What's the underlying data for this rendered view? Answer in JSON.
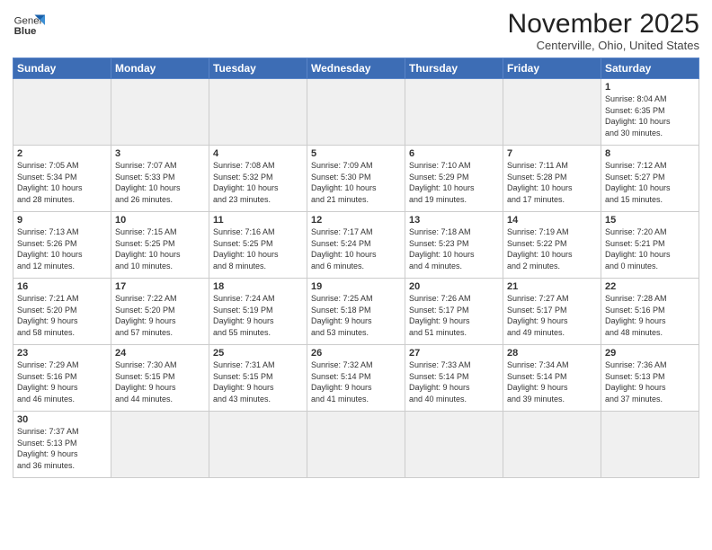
{
  "header": {
    "logo_text_regular": "General",
    "logo_text_bold": "Blue",
    "title": "November 2025",
    "subtitle": "Centerville, Ohio, United States"
  },
  "weekdays": [
    "Sunday",
    "Monday",
    "Tuesday",
    "Wednesday",
    "Thursday",
    "Friday",
    "Saturday"
  ],
  "weeks": [
    [
      {
        "day": "",
        "info": ""
      },
      {
        "day": "",
        "info": ""
      },
      {
        "day": "",
        "info": ""
      },
      {
        "day": "",
        "info": ""
      },
      {
        "day": "",
        "info": ""
      },
      {
        "day": "",
        "info": ""
      },
      {
        "day": "1",
        "info": "Sunrise: 8:04 AM\nSunset: 6:35 PM\nDaylight: 10 hours\nand 30 minutes."
      }
    ],
    [
      {
        "day": "2",
        "info": "Sunrise: 7:05 AM\nSunset: 5:34 PM\nDaylight: 10 hours\nand 28 minutes."
      },
      {
        "day": "3",
        "info": "Sunrise: 7:07 AM\nSunset: 5:33 PM\nDaylight: 10 hours\nand 26 minutes."
      },
      {
        "day": "4",
        "info": "Sunrise: 7:08 AM\nSunset: 5:32 PM\nDaylight: 10 hours\nand 23 minutes."
      },
      {
        "day": "5",
        "info": "Sunrise: 7:09 AM\nSunset: 5:30 PM\nDaylight: 10 hours\nand 21 minutes."
      },
      {
        "day": "6",
        "info": "Sunrise: 7:10 AM\nSunset: 5:29 PM\nDaylight: 10 hours\nand 19 minutes."
      },
      {
        "day": "7",
        "info": "Sunrise: 7:11 AM\nSunset: 5:28 PM\nDaylight: 10 hours\nand 17 minutes."
      },
      {
        "day": "8",
        "info": "Sunrise: 7:12 AM\nSunset: 5:27 PM\nDaylight: 10 hours\nand 15 minutes."
      }
    ],
    [
      {
        "day": "9",
        "info": "Sunrise: 7:13 AM\nSunset: 5:26 PM\nDaylight: 10 hours\nand 12 minutes."
      },
      {
        "day": "10",
        "info": "Sunrise: 7:15 AM\nSunset: 5:25 PM\nDaylight: 10 hours\nand 10 minutes."
      },
      {
        "day": "11",
        "info": "Sunrise: 7:16 AM\nSunset: 5:25 PM\nDaylight: 10 hours\nand 8 minutes."
      },
      {
        "day": "12",
        "info": "Sunrise: 7:17 AM\nSunset: 5:24 PM\nDaylight: 10 hours\nand 6 minutes."
      },
      {
        "day": "13",
        "info": "Sunrise: 7:18 AM\nSunset: 5:23 PM\nDaylight: 10 hours\nand 4 minutes."
      },
      {
        "day": "14",
        "info": "Sunrise: 7:19 AM\nSunset: 5:22 PM\nDaylight: 10 hours\nand 2 minutes."
      },
      {
        "day": "15",
        "info": "Sunrise: 7:20 AM\nSunset: 5:21 PM\nDaylight: 10 hours\nand 0 minutes."
      }
    ],
    [
      {
        "day": "16",
        "info": "Sunrise: 7:21 AM\nSunset: 5:20 PM\nDaylight: 9 hours\nand 58 minutes."
      },
      {
        "day": "17",
        "info": "Sunrise: 7:22 AM\nSunset: 5:20 PM\nDaylight: 9 hours\nand 57 minutes."
      },
      {
        "day": "18",
        "info": "Sunrise: 7:24 AM\nSunset: 5:19 PM\nDaylight: 9 hours\nand 55 minutes."
      },
      {
        "day": "19",
        "info": "Sunrise: 7:25 AM\nSunset: 5:18 PM\nDaylight: 9 hours\nand 53 minutes."
      },
      {
        "day": "20",
        "info": "Sunrise: 7:26 AM\nSunset: 5:17 PM\nDaylight: 9 hours\nand 51 minutes."
      },
      {
        "day": "21",
        "info": "Sunrise: 7:27 AM\nSunset: 5:17 PM\nDaylight: 9 hours\nand 49 minutes."
      },
      {
        "day": "22",
        "info": "Sunrise: 7:28 AM\nSunset: 5:16 PM\nDaylight: 9 hours\nand 48 minutes."
      }
    ],
    [
      {
        "day": "23",
        "info": "Sunrise: 7:29 AM\nSunset: 5:16 PM\nDaylight: 9 hours\nand 46 minutes."
      },
      {
        "day": "24",
        "info": "Sunrise: 7:30 AM\nSunset: 5:15 PM\nDaylight: 9 hours\nand 44 minutes."
      },
      {
        "day": "25",
        "info": "Sunrise: 7:31 AM\nSunset: 5:15 PM\nDaylight: 9 hours\nand 43 minutes."
      },
      {
        "day": "26",
        "info": "Sunrise: 7:32 AM\nSunset: 5:14 PM\nDaylight: 9 hours\nand 41 minutes."
      },
      {
        "day": "27",
        "info": "Sunrise: 7:33 AM\nSunset: 5:14 PM\nDaylight: 9 hours\nand 40 minutes."
      },
      {
        "day": "28",
        "info": "Sunrise: 7:34 AM\nSunset: 5:14 PM\nDaylight: 9 hours\nand 39 minutes."
      },
      {
        "day": "29",
        "info": "Sunrise: 7:36 AM\nSunset: 5:13 PM\nDaylight: 9 hours\nand 37 minutes."
      }
    ],
    [
      {
        "day": "30",
        "info": "Sunrise: 7:37 AM\nSunset: 5:13 PM\nDaylight: 9 hours\nand 36 minutes."
      },
      {
        "day": "",
        "info": ""
      },
      {
        "day": "",
        "info": ""
      },
      {
        "day": "",
        "info": ""
      },
      {
        "day": "",
        "info": ""
      },
      {
        "day": "",
        "info": ""
      },
      {
        "day": "",
        "info": ""
      }
    ]
  ]
}
